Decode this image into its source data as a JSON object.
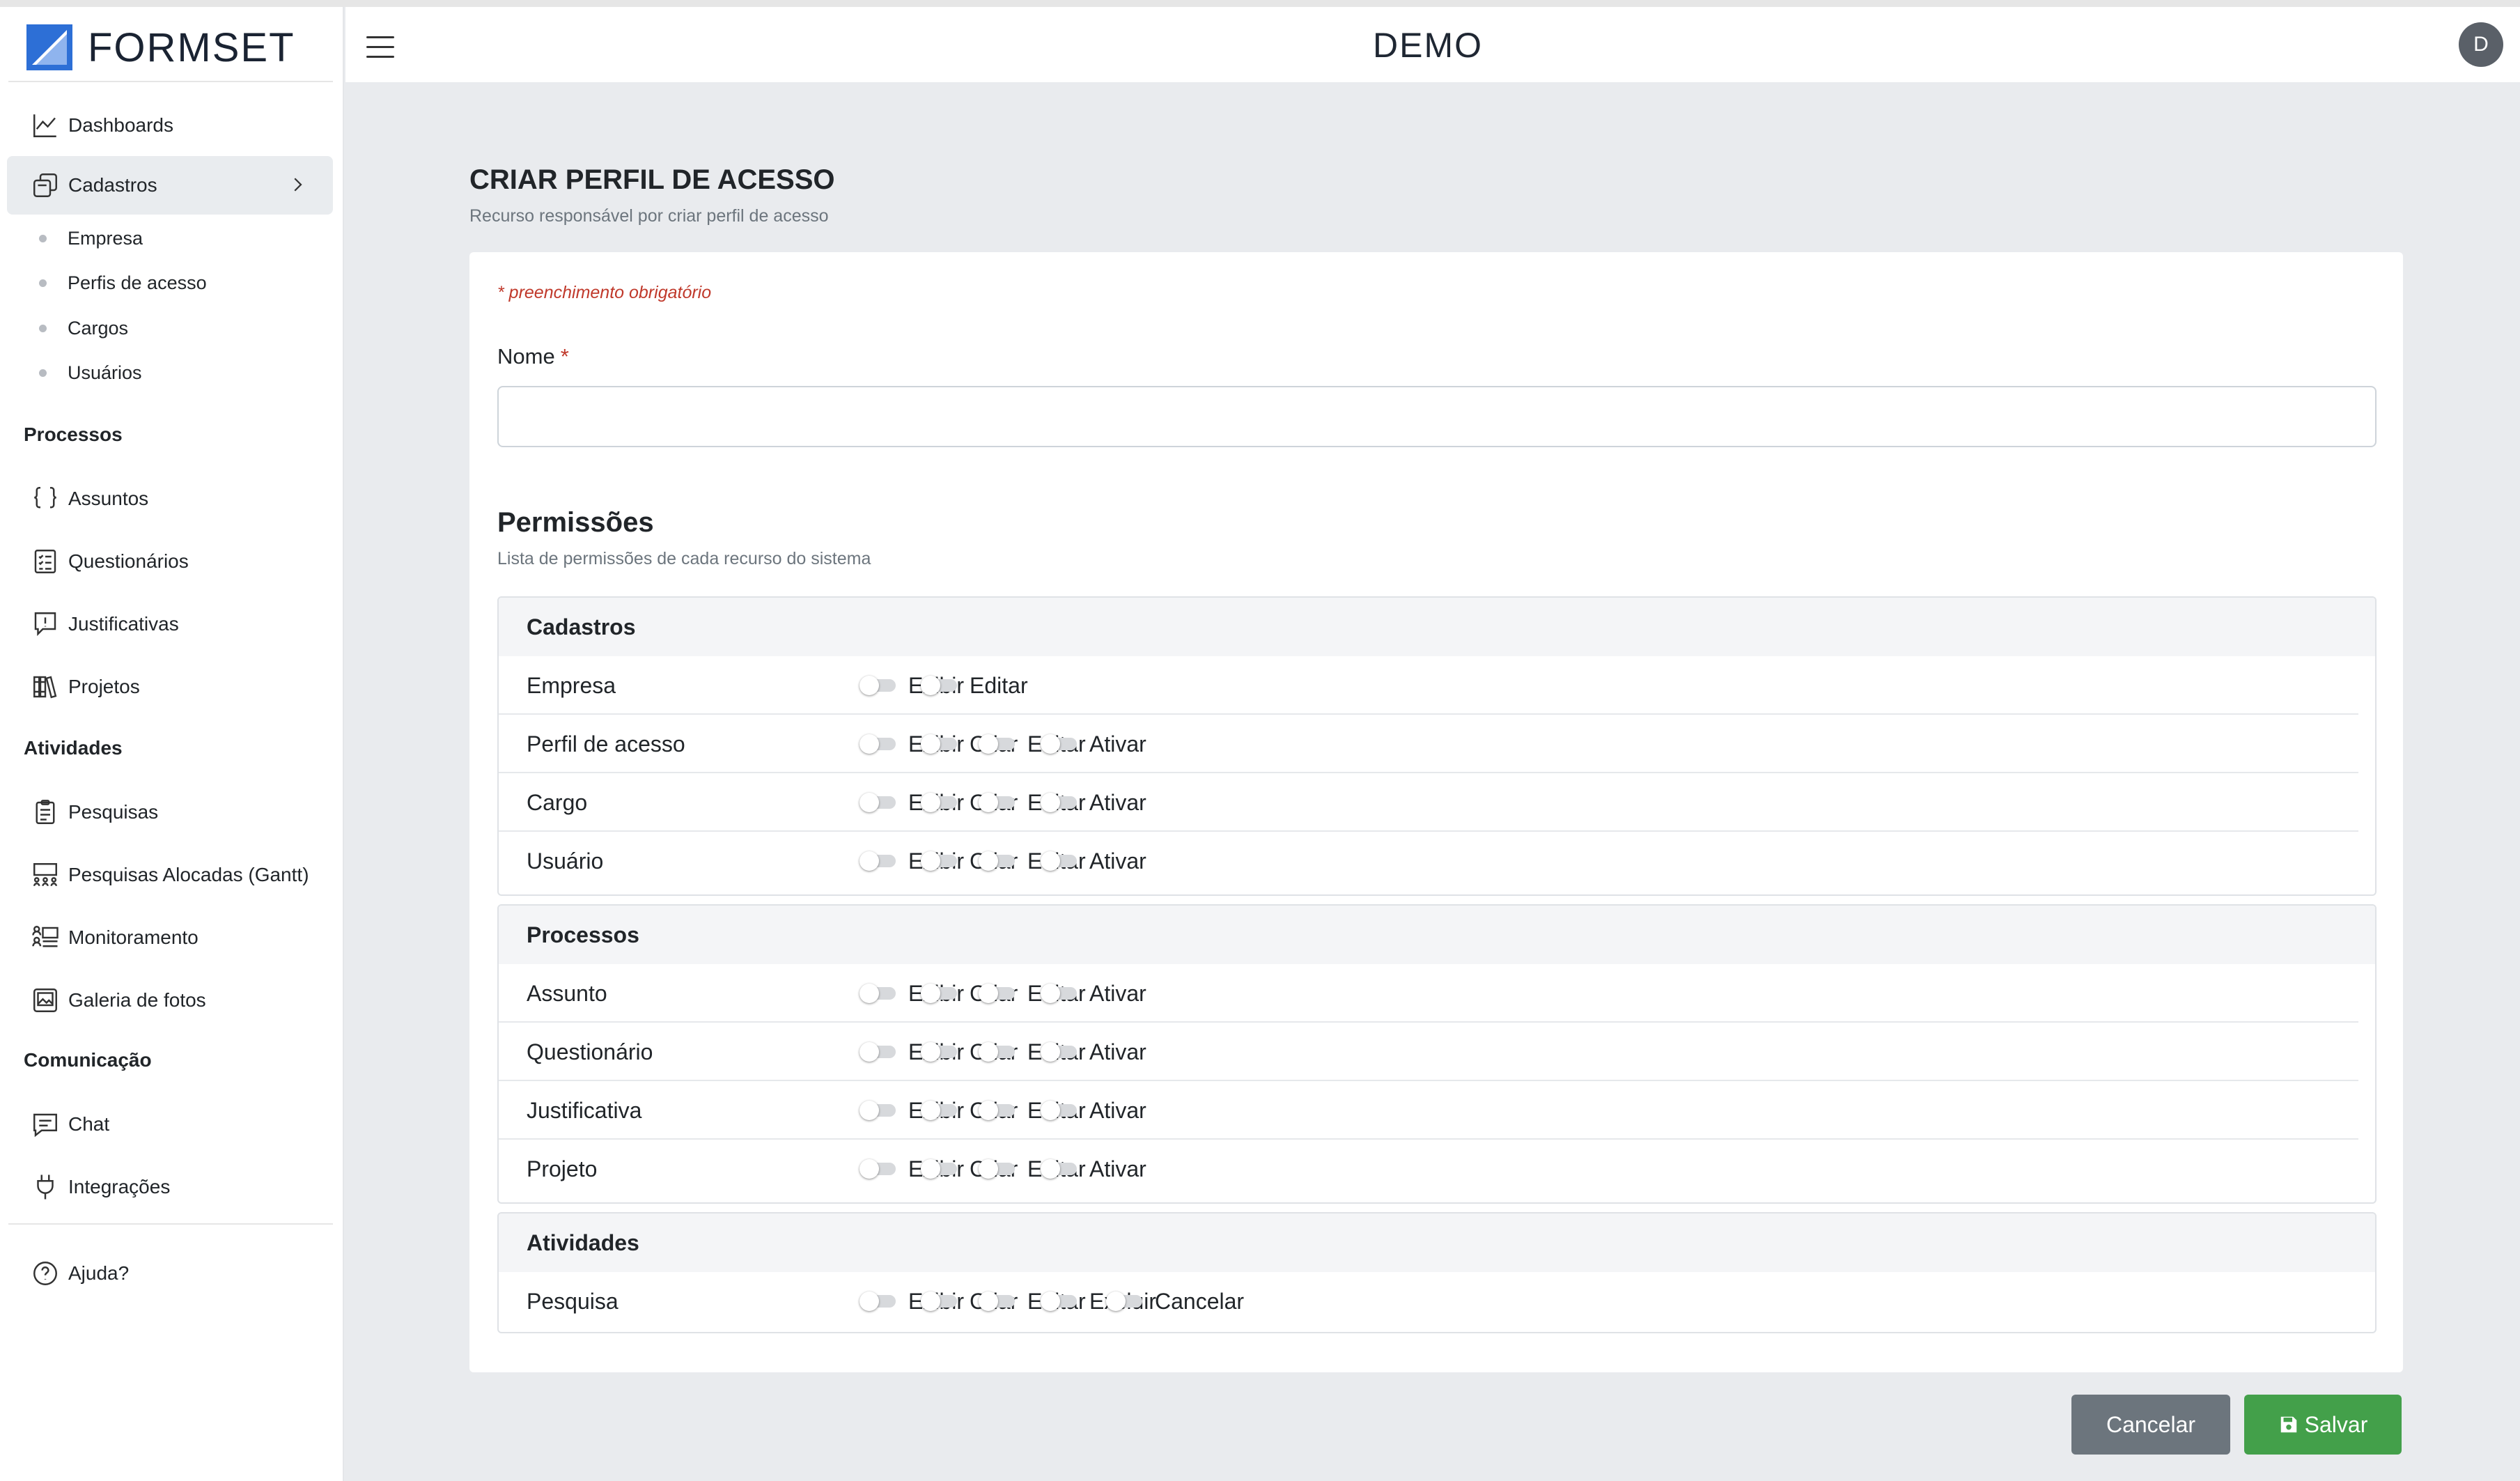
{
  "brand": {
    "name": "FORMSET",
    "colors": {
      "primary": "#2d6fd6",
      "light": "#8fb4ee"
    }
  },
  "header": {
    "title": "DEMO",
    "avatar_initial": "D"
  },
  "sidebar": {
    "dashboards": "Dashboards",
    "cadastros": "Cadastros",
    "cadastros_sub": [
      "Empresa",
      "Perfis de acesso",
      "Cargos",
      "Usuários"
    ],
    "section_processos": "Processos",
    "processos": [
      "Assuntos",
      "Questionários",
      "Justificativas",
      "Projetos"
    ],
    "section_atividades": "Atividades",
    "atividades": [
      "Pesquisas",
      "Pesquisas Alocadas (Gantt)",
      "Monitoramento",
      "Galeria de fotos"
    ],
    "section_comunicacao": "Comunicação",
    "comunicacao": [
      "Chat",
      "Integrações"
    ],
    "ajuda": "Ajuda?"
  },
  "main": {
    "title": "CRIAR PERFIL DE ACESSO",
    "subtitle": "Recurso responsável por criar perfil de acesso",
    "required_note": "* preenchimento obrigatório",
    "name_label": "Nome",
    "required_star": "*",
    "name_value": "",
    "permissions_title": "Permissões",
    "permissions_subtitle": "Lista de permissões de cada recurso do sistema",
    "groups": [
      {
        "title": "Cadastros",
        "rows": [
          {
            "label": "Empresa",
            "options": [
              "Exibir",
              "Editar"
            ]
          },
          {
            "label": "Perfil de acesso",
            "options": [
              "Exibir",
              "Criar",
              "Editar",
              "Ativar"
            ]
          },
          {
            "label": "Cargo",
            "options": [
              "Exibir",
              "Criar",
              "Editar",
              "Ativar"
            ]
          },
          {
            "label": "Usuário",
            "options": [
              "Exibir",
              "Criar",
              "Editar",
              "Ativar"
            ]
          }
        ]
      },
      {
        "title": "Processos",
        "rows": [
          {
            "label": "Assunto",
            "options": [
              "Exibir",
              "Criar",
              "Editar",
              "Ativar"
            ]
          },
          {
            "label": "Questionário",
            "options": [
              "Exibir",
              "Criar",
              "Editar",
              "Ativar"
            ]
          },
          {
            "label": "Justificativa",
            "options": [
              "Exibir",
              "Criar",
              "Editar",
              "Ativar"
            ]
          },
          {
            "label": "Projeto",
            "options": [
              "Exibir",
              "Criar",
              "Editar",
              "Ativar"
            ]
          }
        ]
      },
      {
        "title": "Atividades",
        "rows": [
          {
            "label": "Pesquisa",
            "options": [
              "Exibir",
              "Criar",
              "Editar",
              "Excluir",
              "Cancelar"
            ]
          }
        ]
      }
    ]
  },
  "buttons": {
    "cancel": "Cancelar",
    "save": "Salvar"
  },
  "icons": {
    "dashboards": "chart-line-icon",
    "cadastros": "copy-icon",
    "assuntos": "braces-icon",
    "questionarios": "checklist-icon",
    "justificativas": "alert-message-icon",
    "projetos": "books-icon",
    "pesquisas": "clipboard-icon",
    "gantt": "people-board-icon",
    "monitoramento": "users-monitor-icon",
    "galeria": "image-icon",
    "chat": "chat-icon",
    "integracoes": "plug-icon",
    "ajuda": "help-circle-icon",
    "save": "floppy-disk-icon",
    "menu": "hamburger-icon"
  },
  "all_toggles_off": true
}
